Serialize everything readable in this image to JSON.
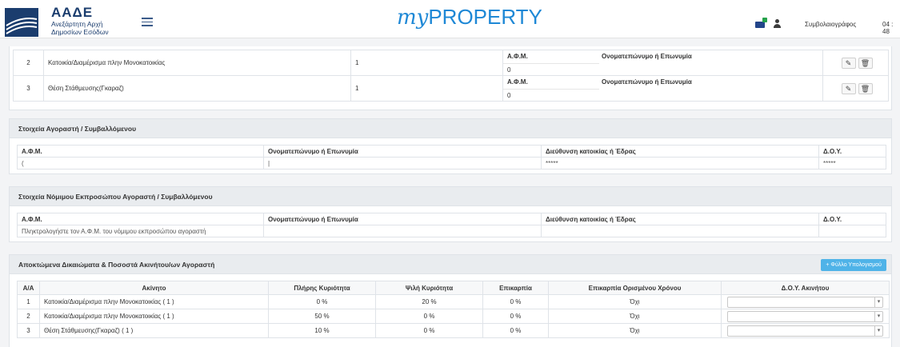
{
  "header": {
    "org_acronym": "ΑΑΔΕ",
    "org_line1": "Ανεξάρτητη Αρχή",
    "org_line2": "Δημοσίων Εσόδων",
    "brand_my": "my",
    "brand_property": "PROPERTY",
    "user_role": "Συμβολαιογράφος",
    "clock": "04 : 48",
    "icons": [
      "menu-icon",
      "messages-icon",
      "user-icon"
    ]
  },
  "properties": {
    "afm_label": "Α.Φ.Μ.",
    "name_label": "Ονοματεπώνυμο ή Επωνυμία",
    "rows": [
      {
        "num": "2",
        "desc": "Κατοικία/Διαμέρισμα πλην Μονοκατοικίας",
        "qty": "1",
        "afm": "0"
      },
      {
        "num": "3",
        "desc": "Θέση Στάθμευσης(Γκαραζ)",
        "qty": "1",
        "afm": "0"
      }
    ]
  },
  "buyer": {
    "title": "Στοιχεία Αγοραστή / Συμβαλλόμενου",
    "cols": [
      "Α.Φ.Μ.",
      "Ονοματεπώνυμο ή Επωνυμία",
      "Διεύθυνση κατοικίας ή Έδρας",
      "Δ.Ο.Υ."
    ],
    "values": [
      "(",
      "|",
      "*****",
      "*****"
    ]
  },
  "legal_rep": {
    "title": "Στοιχεία Νόμιμου Εκπροσώπου Αγοραστή / Συμβαλλόμενου",
    "cols": [
      "Α.Φ.Μ.",
      "Ονοματεπώνυμο ή Επωνυμία",
      "Διεύθυνση κατοικίας ή Έδρας",
      "Δ.Ο.Υ."
    ],
    "afm_placeholder": "Πληκτρολογήστε τον Α.Φ.Μ. του νόμιμου εκπροσώπου αγοραστή"
  },
  "rights": {
    "title": "Αποκτώμενα Δικαιώματα & Ποσοστά Ακινήτου/ων Αγοραστή",
    "calc_button": "+ Φύλλο Υπολογισμού",
    "cols": [
      "Α/Α",
      "Ακίνητο",
      "Πλήρης Κυριότητα",
      "Ψιλή Κυριότητα",
      "Επικαρπία",
      "Επικαρπία Ορισμένου Χρόνου",
      "Δ.Ο.Υ. Ακινήτου"
    ],
    "rows": [
      {
        "num": "1",
        "prop": "Κατοικία/Διαμέρισμα πλην Μονοκατοικίας ( 1 )",
        "full": "0 %",
        "bare": "20 %",
        "usu": "0 %",
        "usu_time": "Όχι"
      },
      {
        "num": "2",
        "prop": "Κατοικία/Διαμέρισμα πλην Μονοκατοικίας ( 1 )",
        "full": "50 %",
        "bare": "0 %",
        "usu": "0 %",
        "usu_time": "Όχι"
      },
      {
        "num": "3",
        "prop": "Θέση Στάθμευσης(Γκαραζ) ( 1 )",
        "full": "10 %",
        "bare": "0 %",
        "usu": "0 %",
        "usu_time": "Όχι"
      }
    ]
  }
}
